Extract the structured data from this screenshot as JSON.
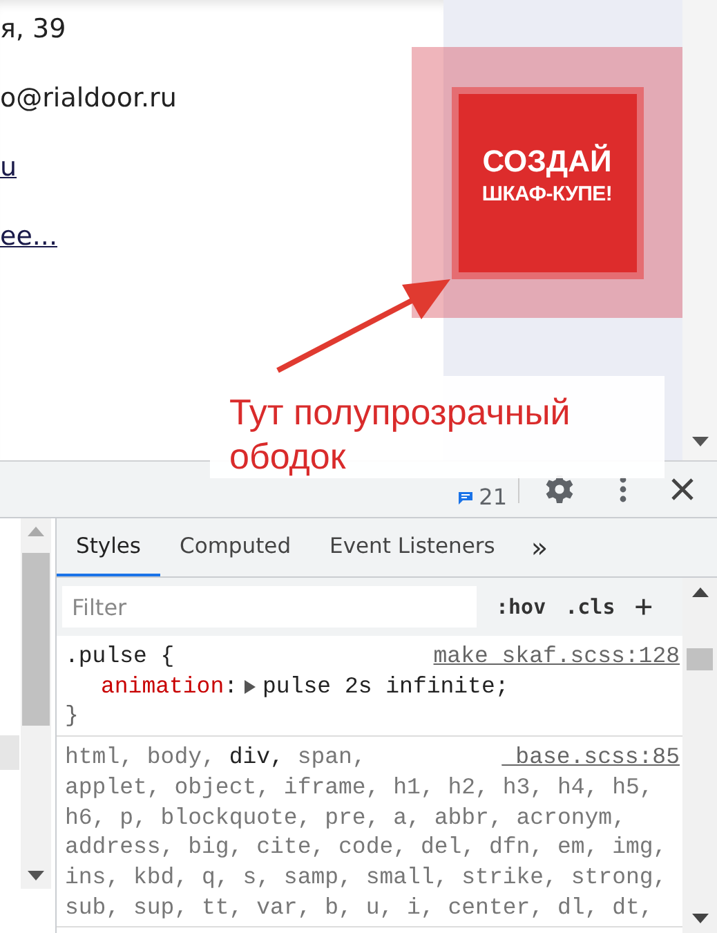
{
  "page": {
    "contact_lines": [
      {
        "kind": "text",
        "text": "я, 39"
      },
      {
        "kind": "text",
        "text": "o@rialdoor.ru"
      },
      {
        "kind": "link",
        "text": "u"
      },
      {
        "kind": "link",
        "text": "ее..."
      }
    ],
    "cta_button": {
      "lines": [
        "СОЗДАЙ",
        "ШКАФ-КУПЕ!"
      ]
    }
  },
  "annotation": {
    "lines": [
      "Тут полупрозрачный",
      "ободок"
    ]
  },
  "devtools": {
    "issues_count": "21",
    "tabs": [
      {
        "label": "Styles",
        "selected": true
      },
      {
        "label": "Computed",
        "selected": false
      },
      {
        "label": "Event Listeners",
        "selected": false
      }
    ],
    "more_tabs": "»",
    "filter": {
      "placeholder": "Filter"
    },
    "hov": ":hov",
    "cls": ".cls",
    "new_rule": "+",
    "rules": [
      {
        "selector_lines": [
          [
            {
              "text": ".pulse {",
              "matched": true
            }
          ]
        ],
        "source": "make_skaf.scss:128",
        "declarations": [
          {
            "property": "animation",
            "colon": ":",
            "value": "pulse 2s infinite;"
          }
        ],
        "close": "}"
      },
      {
        "selector_lines": [
          [
            {
              "text": "html, body, ",
              "matched": false
            },
            {
              "text": "div,",
              "matched": true
            },
            {
              "text": " span,",
              "matched": false
            }
          ],
          [
            {
              "text": "applet, object, iframe, h1, h2, h3, h4, h5,",
              "matched": false
            }
          ],
          [
            {
              "text": "h6, p, blockquote, pre, a, abbr, acronym,",
              "matched": false
            }
          ],
          [
            {
              "text": "address, big, cite, code, del, dfn, em, img,",
              "matched": false
            }
          ],
          [
            {
              "text": "ins, kbd, q, s, samp, small, strike, strong,",
              "matched": false
            }
          ],
          [
            {
              "text": "sub, sup, tt, var, b, u, i, center, dl, dt,",
              "matched": false
            }
          ]
        ],
        "source": "_base.scss:85"
      }
    ]
  }
}
